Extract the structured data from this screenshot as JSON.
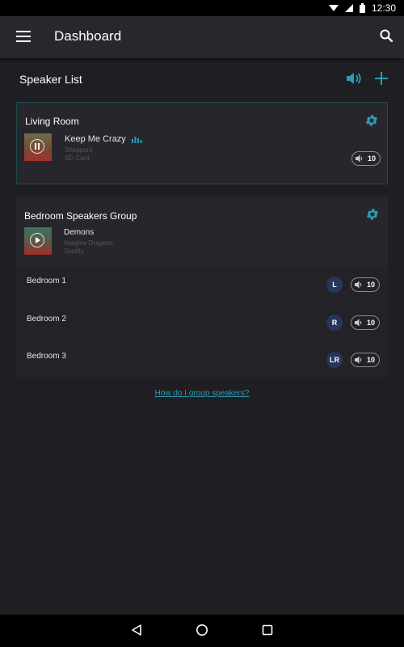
{
  "status_bar": {
    "time": "12:30"
  },
  "app_bar": {
    "title": "Dashboard"
  },
  "section": {
    "title": "Speaker List"
  },
  "living_room": {
    "name": "Living Room",
    "song": "Keep Me Crazy",
    "artist": "Sheppard",
    "source": "SD Card",
    "volume": "10"
  },
  "bedroom_group": {
    "name": "Bedroom Speakers Group",
    "song": "Demons",
    "artist": "Imagine Dragons",
    "source": "Spotify",
    "speakers": [
      {
        "name": "Bedroom 1",
        "channel": "L",
        "volume": "10"
      },
      {
        "name": "Bedroom 2",
        "channel": "R",
        "volume": "10"
      },
      {
        "name": "Bedroom 3",
        "channel": "LR",
        "volume": "10"
      }
    ]
  },
  "help_link": "How do I group speakers?",
  "colors": {
    "accent": "#2b9db0",
    "background": "#1f1e23",
    "card": "#27262c",
    "channel_badge": "#26365c"
  }
}
